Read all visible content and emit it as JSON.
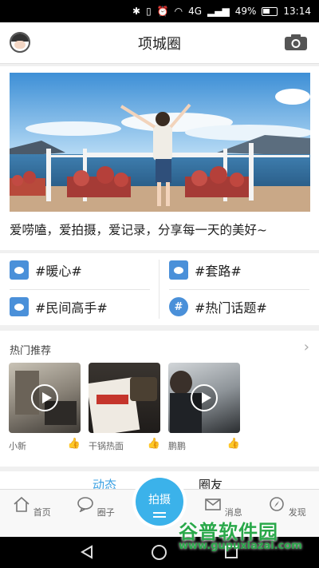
{
  "status_bar": {
    "signal": "4G",
    "battery": "49%",
    "time": "13:14"
  },
  "header": {
    "title": "项城圈"
  },
  "banner": {
    "caption": "爱唠嗑，爱拍摄，爱记录，分享每一天的美好~"
  },
  "topics": [
    {
      "label": "#暖心#"
    },
    {
      "label": "#套路#"
    },
    {
      "label": "#民间高手#"
    },
    {
      "label": "#热门话题#"
    }
  ],
  "recommend": {
    "title": "热门推荐",
    "items": [
      {
        "name": "小新"
      },
      {
        "name": "干锅热面"
      },
      {
        "name": "鹏鹏"
      }
    ]
  },
  "feed_tabs": {
    "active": "动态",
    "other": "圈友"
  },
  "bottom_nav": {
    "home": "首页",
    "circle": "圈子",
    "shoot": "拍摄",
    "messages": "消息",
    "discover": "发现"
  },
  "watermark": {
    "line1": "谷普软件园",
    "line2": "www.gupuxiazai.com"
  },
  "colors": {
    "accent": "#3bb2ea",
    "tag_icon": "#4a90d9",
    "watermark": "#2aa84a"
  }
}
